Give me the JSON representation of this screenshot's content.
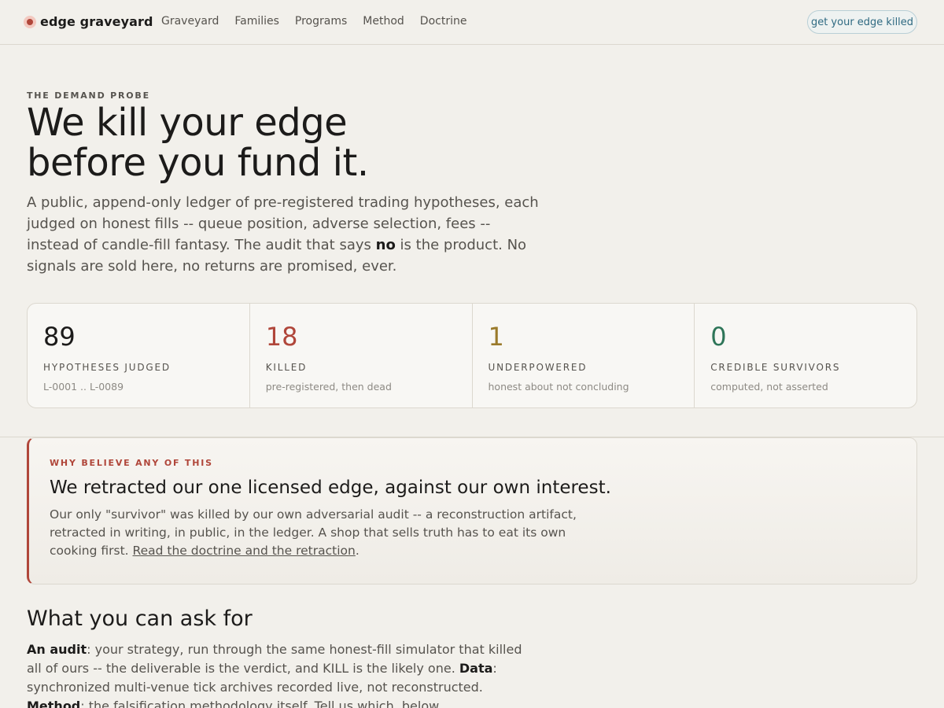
{
  "nav": {
    "brand": "edge graveyard",
    "links": [
      "Graveyard",
      "Families",
      "Programs",
      "Method",
      "Doctrine"
    ],
    "cta": "get your edge killed"
  },
  "hero": {
    "eyebrow": "THE DEMAND PROBE",
    "title_line1": "We kill your edge",
    "title_line2": "before you fund it.",
    "desc_part1": "A public, append-only ledger of pre-registered trading hypotheses, each judged on honest fills -- queue position, adverse selection, fees -- instead of candle-fill fantasy. The audit that says ",
    "desc_bold": "no",
    "desc_part2": " is the product. No signals are sold here, no returns are promised, ever."
  },
  "stats": [
    {
      "value": "89",
      "label": "HYPOTHESES JUDGED",
      "note": "L-0001 .. L-0089",
      "color": "#1c1b1a"
    },
    {
      "value": "18",
      "label": "KILLED",
      "note": "pre-registered, then dead",
      "color": "#b0463a"
    },
    {
      "value": "1",
      "label": "UNDERPOWERED",
      "note": "honest about not concluding",
      "color": "#9a7a2a"
    },
    {
      "value": "0",
      "label": "CREDIBLE SURVIVORS",
      "note": "computed, not asserted",
      "color": "#2e7558"
    }
  ],
  "retraction": {
    "eyebrow": "WHY BELIEVE ANY OF THIS",
    "title": "We retracted our one licensed edge, against our own interest.",
    "text": "Our only \"survivor\" was killed by our own adversarial audit -- a reconstruction artifact, retracted in writing, in public, in the ledger. A shop that sells truth has to eat its own cooking first. ",
    "link": "Read the doctrine and the retraction",
    "text_end": "."
  },
  "ask": {
    "title": "What you can ask for",
    "audit_label": "An audit",
    "audit_text": ": your strategy, run through the same honest-fill simulator that killed all of ours -- the deliverable is the verdict, and KILL is the likely one. ",
    "data_label": "Data",
    "data_text": ": synchronized multi-venue tick archives recorded live, not reconstructed. ",
    "method_label": "Method",
    "method_text": ": the falsification methodology itself. Tell us which, below."
  },
  "colors": {
    "background": "#f2f0eb",
    "accent_red": "#b0463a",
    "accent_gold": "#9a7a2a",
    "accent_green": "#2e7558",
    "cta_blue": "#2f6a82"
  }
}
